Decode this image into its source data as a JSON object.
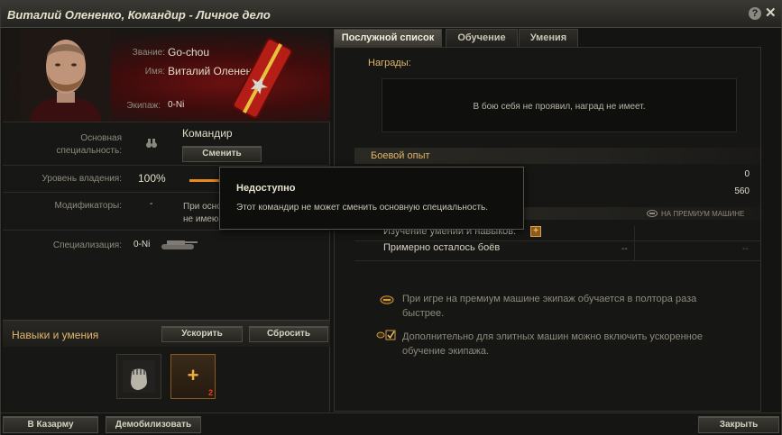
{
  "window": {
    "title": "Виталий Олененко, Командир - Личное дело",
    "help_label": "?",
    "close_label": "✕"
  },
  "profile": {
    "rank_label": "Звание:",
    "rank_value": "Go-chou",
    "name_label": "Имя:",
    "name_value": "Виталий Олененко",
    "crew_label": "Экипаж:",
    "crew_value": "0-Ni"
  },
  "specialty": {
    "label_line1": "Основная",
    "label_line2": "специальность:",
    "value": "Командир",
    "change_button": "Сменить"
  },
  "mastery": {
    "label": "Уровень владения:",
    "value": "100%",
    "progress": 1.0
  },
  "modifiers": {
    "label": "Модификаторы:",
    "value": "-",
    "note_line1": "При осно",
    "note_line2": "не имею"
  },
  "specialization": {
    "label": "Специализация:",
    "value": "0-Ni"
  },
  "skills": {
    "title": "Навыки и умения",
    "accelerate_button": "Ускорить",
    "reset_button": "Сбросить",
    "add_plus": "+",
    "available_count": "2"
  },
  "tabs": [
    {
      "label": "Послужной список",
      "active": true
    },
    {
      "label": "Обучение",
      "active": false
    },
    {
      "label": "Умения",
      "active": false
    }
  ],
  "service": {
    "awards_label": "Награды:",
    "awards_empty": "В бою себя не проявил, наград не имеет.",
    "combat_exp_label": "Боевой опыт",
    "exp_value_1": "0",
    "exp_value_2": "560",
    "premium_tag": "НА ПРЕМИУМ МАШИНЕ",
    "study_label": "Изучение умений и навыков:",
    "study_plus": "+",
    "battles_left_label": "Примерно осталось боёв",
    "battles_left_value": "--",
    "battles_left_premium": "--",
    "info_1_line1": "При игре на премиум машине экипаж обучается в полтора раза",
    "info_1_line2": "быстрее.",
    "info_2_line1": "Дополнительно для элитных машин можно включить ускоренное",
    "info_2_line2": "обучение экипажа."
  },
  "tooltip": {
    "title": "Недоступно",
    "text": "Этот командир не может сменить основную специальность."
  },
  "bottom": {
    "barracks_button": "В Казарму",
    "demobilize_button": "Демобилизовать",
    "close_button": "Закрыть"
  },
  "colors": {
    "accent": "#e0b76a",
    "progress": "#e58a1e",
    "count_red": "#f03a1a"
  }
}
